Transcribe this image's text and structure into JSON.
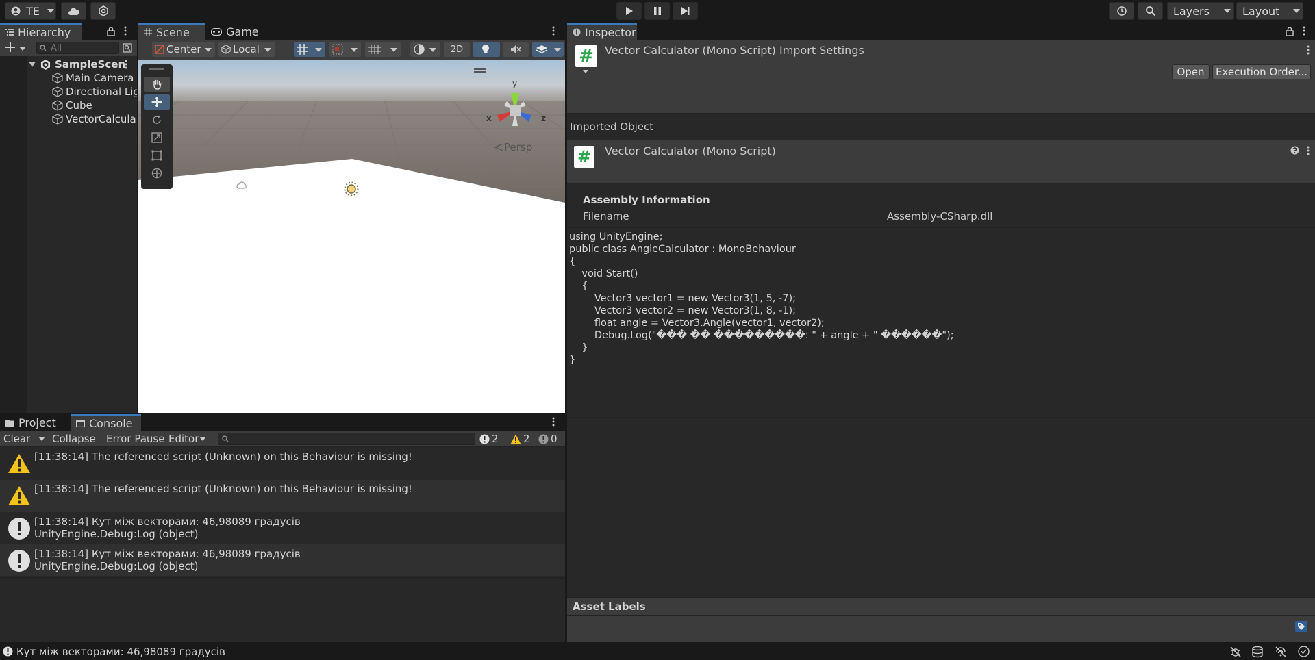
{
  "toolbar": {
    "account_label": "TE",
    "layers_label": "Layers",
    "layout_label": "Layout"
  },
  "hierarchy": {
    "tab_label": "Hierarchy",
    "search_placeholder": "All",
    "scene_name": "SampleScen",
    "items": [
      {
        "label": "Main Camera"
      },
      {
        "label": "Directional Lig"
      },
      {
        "label": "Cube"
      },
      {
        "label": "VectorCalcula"
      }
    ]
  },
  "scene": {
    "tabs": [
      {
        "label": "Scene"
      },
      {
        "label": "Game"
      }
    ],
    "pivot_label": "Center",
    "space_label": "Local",
    "mode_2d_label": "2D",
    "gizmo": {
      "x": "x",
      "y": "y",
      "z": "z",
      "persp": "Persp"
    }
  },
  "inspector": {
    "tab_label": "Inspector",
    "title": "Vector Calculator (Mono Script) Import Settings",
    "open_label": "Open",
    "execution_order_label": "Execution Order...",
    "imported_object_label": "Imported Object",
    "object_title": "Vector Calculator (Mono Script)",
    "assembly_header": "Assembly Information",
    "filename_label": "Filename",
    "filename_value": "Assembly-CSharp.dll",
    "code_lines": [
      "using UnityEngine;",
      "",
      "public class AngleCalculator : MonoBehaviour",
      "{",
      "    void Start()",
      "    {",
      "        Vector3 vector1 = new Vector3(1, 5, -7);",
      "        Vector3 vector2 = new Vector3(1, 8, -1);",
      "",
      "        float angle = Vector3.Angle(vector1, vector2);",
      "",
      "        Debug.Log(\"��� �� ���������: \" + angle + \" ������\");",
      "    }",
      "}"
    ],
    "asset_labels_header": "Asset Labels"
  },
  "console": {
    "tabs": [
      {
        "label": "Project"
      },
      {
        "label": "Console"
      }
    ],
    "clear_label": "Clear",
    "collapse_label": "Collapse",
    "error_pause_label": "Error Pause",
    "editor_label": "Editor",
    "counts": {
      "info": "2",
      "warning": "2",
      "error": "0"
    },
    "rows": [
      {
        "type": "warning",
        "line1": "[11:38:14] The referenced script (Unknown) on this Behaviour is missing!",
        "line2": ""
      },
      {
        "type": "warning",
        "line1": "[11:38:14] The referenced script (Unknown) on this Behaviour is missing!",
        "line2": ""
      },
      {
        "type": "info",
        "line1": "[11:38:14] Кут між векторами: 46,98089 градусів",
        "line2": "UnityEngine.Debug:Log (object)"
      },
      {
        "type": "info",
        "line1": "[11:38:14] Кут між векторами: 46,98089 градусів",
        "line2": "UnityEngine.Debug:Log (object)"
      }
    ]
  },
  "statusbar": {
    "message": "Кут між векторами: 46,98089 градусів"
  },
  "colors": {
    "accent_blue": "#3a79bb",
    "warning_yellow": "#f4c21a",
    "script_green": "#2ea44f"
  }
}
